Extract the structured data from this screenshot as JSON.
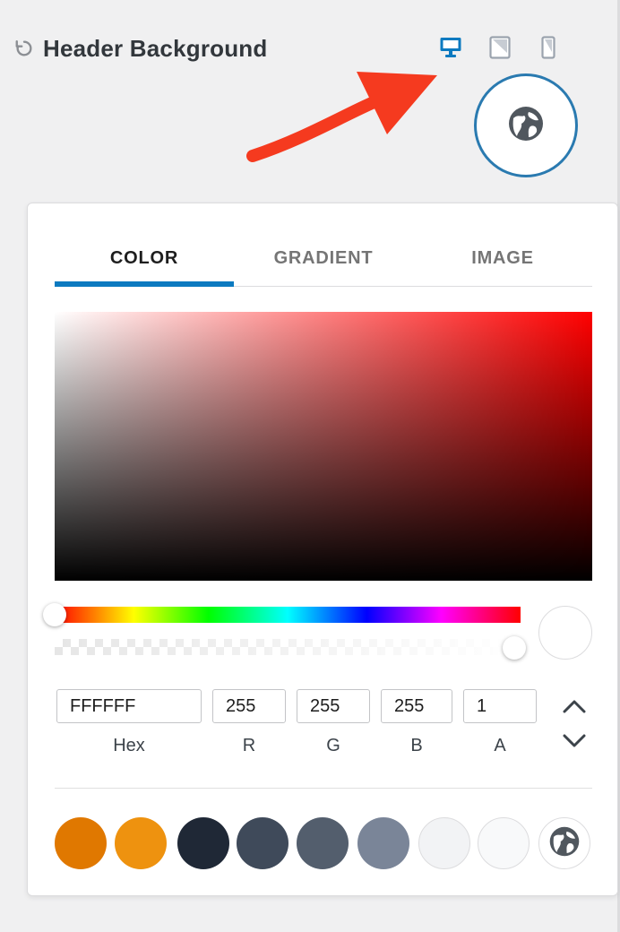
{
  "header": {
    "title": "Header Background",
    "devices": [
      "desktop-icon",
      "tablet-icon",
      "mobile-icon"
    ],
    "active_device": "desktop"
  },
  "picker": {
    "tabs": [
      {
        "label": "COLOR",
        "active": true
      },
      {
        "label": "GRADIENT",
        "active": false
      },
      {
        "label": "IMAGE",
        "active": false
      }
    ],
    "current_color": "#FFFFFF",
    "hue_base": "#FF0000",
    "hue_level": 0,
    "alpha_level": 1,
    "fields": {
      "hex": {
        "value": "FFFFFF",
        "label": "Hex"
      },
      "r": {
        "value": "255",
        "label": "R"
      },
      "g": {
        "value": "255",
        "label": "G"
      },
      "b": {
        "value": "255",
        "label": "B"
      },
      "a": {
        "value": "1",
        "label": "A"
      }
    },
    "palette": [
      "#E07800",
      "#EE920F",
      "#1F2836",
      "#3F4A5A",
      "#535E6D",
      "#7A8598",
      "#F2F3F5",
      "#F8F9FA"
    ],
    "palette_global_icon": "globe-icon"
  },
  "colors": {
    "accent": "#0C7AC0",
    "global_button_border": "#2A7AB0",
    "annotation_arrow": "#F53A1F"
  }
}
